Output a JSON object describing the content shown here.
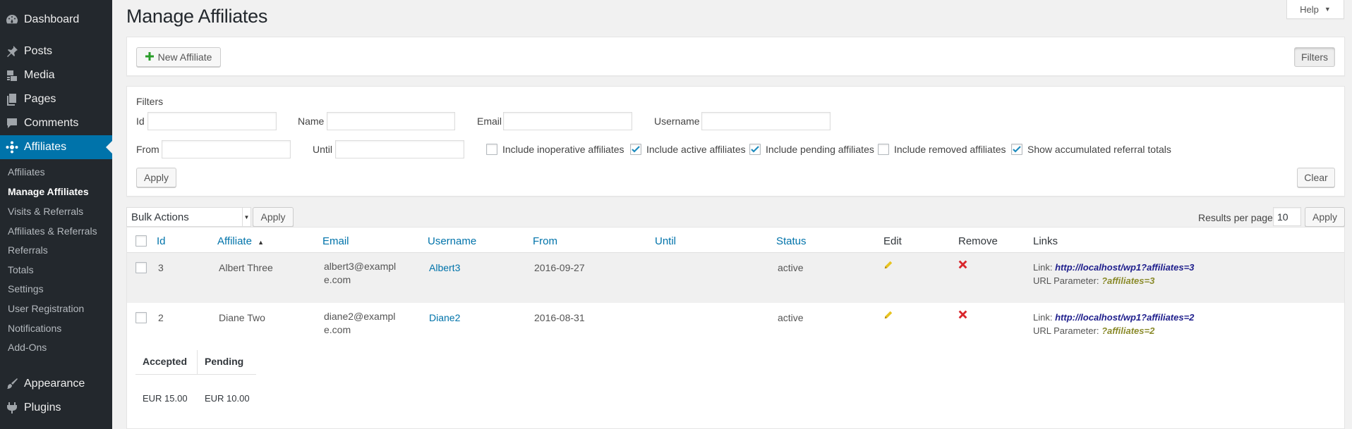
{
  "sidebar": {
    "items": [
      {
        "label": "Dashboard",
        "icon": "dashboard-icon"
      },
      {
        "label": "Posts",
        "icon": "pin-icon"
      },
      {
        "label": "Media",
        "icon": "media-icon"
      },
      {
        "label": "Pages",
        "icon": "pages-icon"
      },
      {
        "label": "Comments",
        "icon": "comment-icon"
      },
      {
        "label": "Affiliates",
        "icon": "affiliates-icon"
      },
      {
        "label": "Appearance",
        "icon": "paintbrush-icon"
      },
      {
        "label": "Plugins",
        "icon": "plugin-icon"
      }
    ],
    "submenu": [
      "Affiliates",
      "Manage Affiliates",
      "Visits & Referrals",
      "Affiliates & Referrals",
      "Referrals",
      "Totals",
      "Settings",
      "User Registration",
      "Notifications",
      "Add-Ons"
    ]
  },
  "help_label": "Help",
  "page_title": "Manage Affiliates",
  "toolbar": {
    "new_affiliate": "New Affiliate",
    "filters": "Filters"
  },
  "filters": {
    "heading": "Filters",
    "id_label": "Id",
    "name_label": "Name",
    "email_label": "Email",
    "username_label": "Username",
    "from_label": "From",
    "until_label": "Until",
    "id_value": "",
    "name_value": "",
    "email_value": "",
    "username_value": "",
    "from_value": "",
    "until_value": "",
    "checkboxes": [
      {
        "label": "Include inoperative affiliates",
        "checked": false
      },
      {
        "label": "Include active affiliates",
        "checked": true
      },
      {
        "label": "Include pending affiliates",
        "checked": true
      },
      {
        "label": "Include removed affiliates",
        "checked": false
      },
      {
        "label": "Show accumulated referral totals",
        "checked": true
      }
    ],
    "apply": "Apply",
    "clear": "Clear"
  },
  "bulk": {
    "selected": "Bulk Actions",
    "apply": "Apply"
  },
  "paging": {
    "results_label": "Results per page",
    "results_value": "10",
    "apply": "Apply"
  },
  "table": {
    "columns": [
      "Id",
      "Affiliate",
      "Email",
      "Username",
      "From",
      "Until",
      "Status",
      "Edit",
      "Remove",
      "Links"
    ],
    "rows": [
      {
        "id": "3",
        "affiliate": "Albert Three",
        "email": "albert3@example.com",
        "username": "Albert3",
        "from": "2016-09-27",
        "until": "",
        "status": "active",
        "link_label": "Link:",
        "link": "http://localhost/wp1?affiliates=3",
        "param_label": "URL Parameter:",
        "param": "?affiliates=3"
      },
      {
        "id": "2",
        "affiliate": "Diane Two",
        "email": "diane2@example.com",
        "username": "Diane2",
        "from": "2016-08-31",
        "until": "",
        "status": "active",
        "link_label": "Link:",
        "link": "http://localhost/wp1?affiliates=2",
        "param_label": "URL Parameter:",
        "param": "?affiliates=2"
      }
    ]
  },
  "totals": {
    "headers": [
      "Accepted",
      "Pending"
    ],
    "values": [
      "EUR 15.00",
      "EUR 10.00"
    ]
  },
  "colors": {
    "sidebar_bg": "#23282d",
    "accent": "#0073aa",
    "add_green": "#2a9d2a",
    "remove_red": "#d9262c",
    "edit_yellow": "#e8c421"
  }
}
